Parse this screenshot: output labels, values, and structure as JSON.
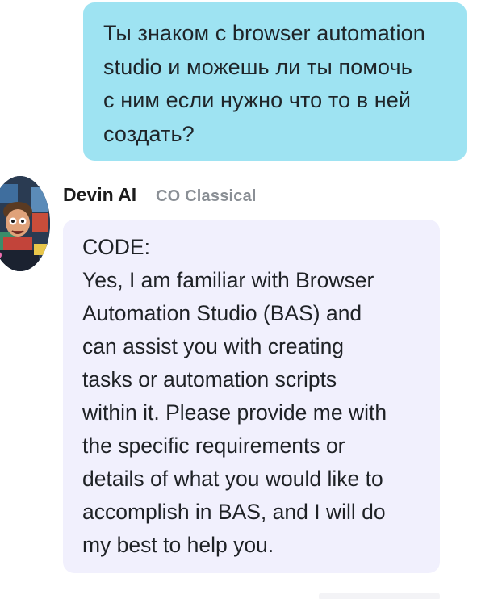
{
  "user_message": {
    "lines": [
      "Ты знаком с browser automation",
      "studio и можешь ли ты помочь",
      "с ним если нужно что то в ней",
      "создать?"
    ]
  },
  "bot": {
    "name": "Devin AI",
    "meta": "CO Classical",
    "avatar_icon": "robot-avatar-icon",
    "lines": [
      "CODE:",
      "Yes, I am familiar with Browser",
      "Automation Studio (BAS) and",
      "can assist you with creating",
      "tasks or automation scripts",
      "within it. Please provide me with",
      "the specific requirements or",
      "details of what you would like to",
      "accomplish in BAS, and I will do",
      "my best to help you."
    ]
  },
  "colors": {
    "user_bubble": "#9ee3f2",
    "bot_bubble": "#f1f0fd",
    "meta_text": "#8a8f95"
  }
}
